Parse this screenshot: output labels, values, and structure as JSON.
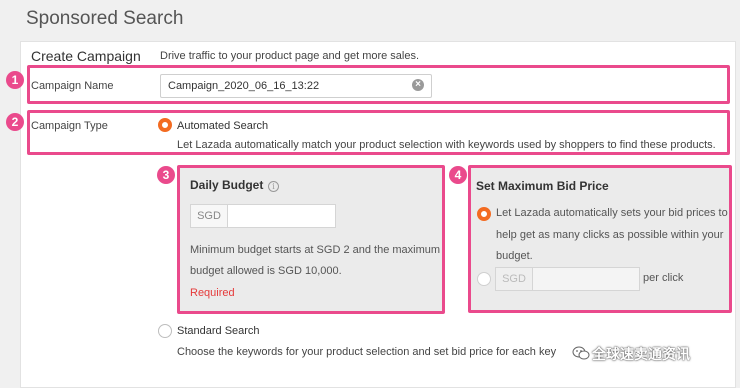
{
  "page": {
    "title": "Sponsored Search"
  },
  "section": {
    "title": "Create Campaign",
    "description": "Drive traffic to your product page and get more sales."
  },
  "badges": [
    "1",
    "2",
    "3",
    "4"
  ],
  "campaign_name": {
    "label": "Campaign Name",
    "value": "Campaign_2020_06_16_13:22",
    "clear_glyph": "×"
  },
  "campaign_type": {
    "label": "Campaign Type",
    "automated": {
      "label": "Automated Search",
      "description": "Let Lazada automatically match your product selection with keywords used by shoppers to find these products.",
      "selected": true
    },
    "standard": {
      "label": "Standard Search",
      "description": "Choose the keywords for your product selection and set bid price for each key",
      "selected": false
    }
  },
  "daily_budget": {
    "title": "Daily Budget",
    "info_glyph": "i",
    "currency": "SGD",
    "value": "",
    "note_line1": "Minimum budget starts at SGD 2 and the maximum",
    "note_line2": "budget allowed is SGD 10,000.",
    "error": "Required"
  },
  "max_bid": {
    "title": "Set Maximum Bid Price",
    "auto_line1": "Let Lazada automatically sets your bid prices to",
    "auto_line2": "help get as many clicks as possible within your",
    "auto_line3": "budget.",
    "currency": "SGD",
    "value": "",
    "suffix": "per click"
  },
  "watermark": {
    "text": "全球速卖通资讯"
  },
  "colors": {
    "highlight": "#ea4a8c",
    "radio_selected": "#f36b21",
    "error": "#e53a3a"
  }
}
